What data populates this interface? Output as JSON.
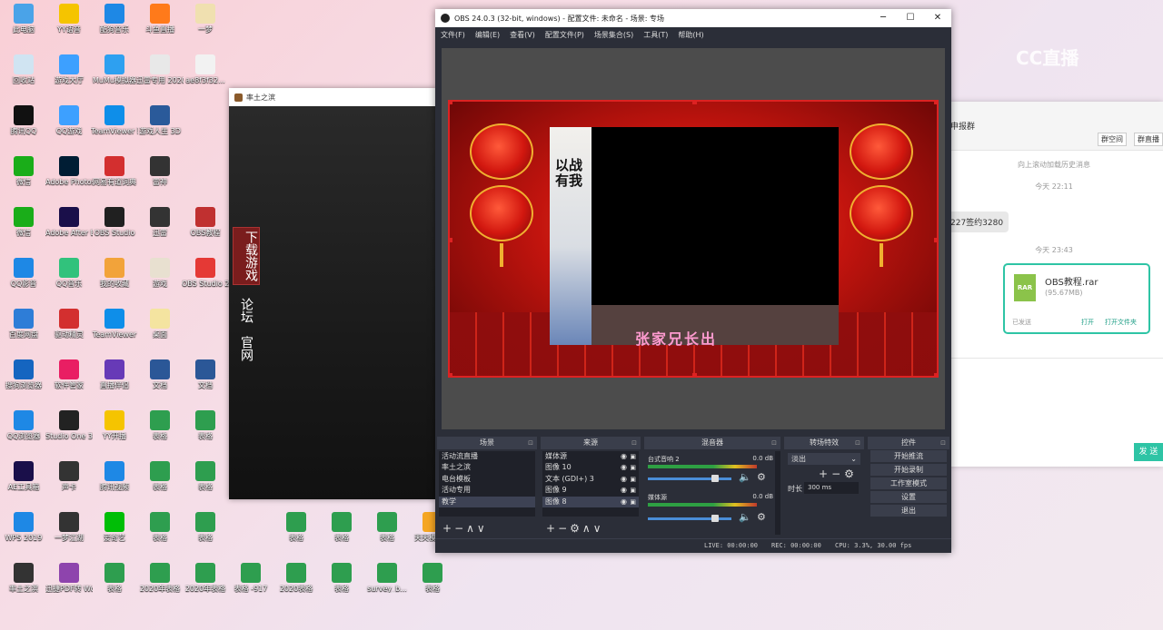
{
  "desktop": {
    "icons": [
      {
        "label": "此电脑",
        "icon": "computer-icon",
        "color": "#4aa3e8"
      },
      {
        "label": "YY语音",
        "icon": "yy-icon",
        "color": "#f5c400"
      },
      {
        "label": "酷狗音乐",
        "icon": "kugou-icon",
        "color": "#1e88e5"
      },
      {
        "label": "斗鱼直播",
        "icon": "douyu-icon",
        "color": "#ff7a1a"
      },
      {
        "label": "一梦",
        "icon": "app-icon",
        "color": "#f0e0b0"
      },
      {
        "label": "回收站",
        "icon": "recycle-bin-icon",
        "color": "#d0e4f2"
      },
      {
        "label": "游戏大厅",
        "icon": "game-hall-icon",
        "color": "#3da0ff"
      },
      {
        "label": "MuMu模拟器",
        "icon": "mumu-icon",
        "color": "#2ea0f0"
      },
      {
        "label": "迅雷专用 2020020...",
        "icon": "file-icon",
        "color": "#e8e8e8"
      },
      {
        "label": "ae8f3f32...",
        "icon": "file-icon",
        "color": "#f2f2f2"
      },
      {
        "label": "腾讯QQ",
        "icon": "qq-icon",
        "color": "#111111"
      },
      {
        "label": "QQ游戏",
        "icon": "qq-game-icon",
        "color": "#3da0ff"
      },
      {
        "label": "TeamViewer 取消(打开)",
        "icon": "teamviewer-icon",
        "color": "#0e8ee9"
      },
      {
        "label": "游戏人生 3D",
        "icon": "game-icon",
        "color": "#2a5a9a"
      },
      {
        "label": "微信",
        "icon": "wechat-icon",
        "color": "#1aad19"
      },
      {
        "label": "Adobe Photosh...",
        "icon": "photoshop-icon",
        "color": "#001d34"
      },
      {
        "label": "网易有道词典",
        "icon": "youdao-icon",
        "color": "#d32f2f"
      },
      {
        "label": "雷神",
        "icon": "device-icon",
        "color": "#333333"
      },
      {
        "label": "微信",
        "icon": "wechat-icon",
        "color": "#1aad19"
      },
      {
        "label": "Adobe After Effects 2019",
        "icon": "after-effects-icon",
        "color": "#1a0f4a"
      },
      {
        "label": "OBS Studio",
        "icon": "obs-icon",
        "color": "#202020"
      },
      {
        "label": "迅雷",
        "icon": "device-icon",
        "color": "#333333"
      },
      {
        "label": "OBS教程",
        "icon": "archive-icon",
        "color": "#c03030"
      },
      {
        "label": "QQ影音",
        "icon": "qq-player-icon",
        "color": "#1e88e5"
      },
      {
        "label": "QQ音乐",
        "icon": "qq-music-icon",
        "color": "#31c27c"
      },
      {
        "label": "我的收藏",
        "icon": "folder-icon",
        "color": "#f2a33a"
      },
      {
        "label": "游戏",
        "icon": "folder-icon",
        "color": "#e8e0d0"
      },
      {
        "label": "OBS Studio 21.1 GC下...",
        "icon": "pdf-icon",
        "color": "#e53935"
      },
      {
        "label": "百度网盘",
        "icon": "baidu-netdisk-icon",
        "color": "#2e7dd7"
      },
      {
        "label": "驱动精灵",
        "icon": "driver-icon",
        "color": "#d32f2f"
      },
      {
        "label": "TeamViewer",
        "icon": "teamviewer-icon",
        "color": "#0e8ee9"
      },
      {
        "label": "桌面",
        "icon": "folder-icon",
        "color": "#f4e4a0"
      },
      {
        "label": "搜狗浏览器",
        "icon": "sogou-icon",
        "color": "#1565c0"
      },
      {
        "label": "软件管家",
        "icon": "software-icon",
        "color": "#e91e63"
      },
      {
        "label": "直播伴侣",
        "icon": "live-icon",
        "color": "#673ab7"
      },
      {
        "label": "文档",
        "icon": "word-icon",
        "color": "#2b5797"
      },
      {
        "label": "文档",
        "icon": "word-icon",
        "color": "#2b5797"
      },
      {
        "label": "QQ浏览器",
        "icon": "qq-browser-icon",
        "color": "#1e88e5"
      },
      {
        "label": "Studio One 3",
        "icon": "studio-one-icon",
        "color": "#222222"
      },
      {
        "label": "YY开播",
        "icon": "yy-live-icon",
        "color": "#f5c400"
      },
      {
        "label": "表格",
        "icon": "excel-icon",
        "color": "#2e9e4f"
      },
      {
        "label": "表格",
        "icon": "excel-icon",
        "color": "#2e9e4f"
      },
      {
        "label": "AE工具箱",
        "icon": "ae-tool-icon",
        "color": "#1a0f4a"
      },
      {
        "label": "声卡",
        "icon": "app-icon",
        "color": "#333333"
      },
      {
        "label": "腾讯视频",
        "icon": "tencent-video-icon",
        "color": "#1e88e5"
      },
      {
        "label": "表格",
        "icon": "excel-icon",
        "color": "#2e9e4f"
      },
      {
        "label": "表格",
        "icon": "excel-icon",
        "color": "#2e9e4f"
      },
      {
        "label": "WPS 2019",
        "icon": "wps-icon",
        "color": "#1e88e5"
      },
      {
        "label": "一梦江湖",
        "icon": "game-icon",
        "color": "#333333"
      },
      {
        "label": "爱奇艺",
        "icon": "iqiyi-icon",
        "color": "#00be06"
      },
      {
        "label": "表格",
        "icon": "excel-icon",
        "color": "#2e9e4f"
      },
      {
        "label": "表格",
        "icon": "excel-icon",
        "color": "#2e9e4f"
      },
      {
        "label": "表格",
        "icon": "excel-icon",
        "color": "#2e9e4f"
      },
      {
        "label": "表格",
        "icon": "excel-icon",
        "color": "#2e9e4f"
      },
      {
        "label": "表格",
        "icon": "excel-icon",
        "color": "#2e9e4f"
      },
      {
        "label": "天天模拟器",
        "icon": "emulator-icon",
        "color": "#f5a623"
      },
      {
        "label": "率土之滨",
        "icon": "game-icon",
        "color": "#333333"
      },
      {
        "label": "迅捷PDF转 Word",
        "icon": "pdf-word-icon",
        "color": "#8e44ad"
      },
      {
        "label": "表格",
        "icon": "excel-icon",
        "color": "#2e9e4f"
      },
      {
        "label": "2020年表格",
        "icon": "excel-icon",
        "color": "#2e9e4f"
      },
      {
        "label": "2020年表格",
        "icon": "excel-icon",
        "color": "#2e9e4f"
      },
      {
        "label": "表格 -917",
        "icon": "excel-icon",
        "color": "#2e9e4f"
      },
      {
        "label": "2020表格",
        "icon": "excel-icon",
        "color": "#2e9e4f"
      },
      {
        "label": "表格",
        "icon": "excel-icon",
        "color": "#2e9e4f"
      },
      {
        "label": "survey_b...",
        "icon": "excel-icon",
        "color": "#2e9e4f"
      },
      {
        "label": "表格",
        "icon": "excel-icon",
        "color": "#2e9e4f"
      }
    ]
  },
  "launcher": {
    "title": "率土之滨",
    "download": "下载游戏",
    "forum": "论坛",
    "site": "官网"
  },
  "chat": {
    "title": "申报群",
    "btn1": "群空间",
    "btn2": "群直播",
    "history": "向上滚动加载历史消息",
    "time1": "今天 22:11",
    "message": "227签约3280",
    "time2": "今天 23:43",
    "file_name": "OBS教程.rar",
    "file_size": "(95.67MB)",
    "file_type": "RAR",
    "sent": "已发送",
    "open": "打开",
    "open_folder": "打开文件夹",
    "send": "发 送",
    "watermark": "CC直播"
  },
  "obs": {
    "title": "OBS 24.0.3 (32-bit, windows) - 配置文件: 未命名 - 场景: 专场",
    "menu": [
      "文件(F)",
      "编辑(E)",
      "查看(V)",
      "配置文件(P)",
      "场景集合(S)",
      "工具(T)",
      "帮助(H)"
    ],
    "preview": {
      "poster_text": "以战有我",
      "banner_text": "张家兄长出"
    },
    "scenes": {
      "header": "场景",
      "items": [
        "活动流直播",
        "率土之滨",
        "电台模板",
        "活动专用",
        "教学"
      ],
      "selected": 4
    },
    "sources": {
      "header": "来源",
      "items": [
        "媒体源",
        "图像 10",
        "文本 (GDI+) 3",
        "图像 9",
        "图像 8"
      ],
      "selected": 4
    },
    "mixer": {
      "header": "混音器",
      "channels": [
        {
          "name": "台式音响 2",
          "db": "0.0 dB",
          "volume": 0.8
        },
        {
          "name": "媒体源",
          "db": "0.0 dB",
          "volume": 0.8
        }
      ]
    },
    "transitions": {
      "header": "转场特效",
      "type": "淡出",
      "duration_label": "时长",
      "duration": "300 ms"
    },
    "controls": {
      "header": "控件",
      "buttons": [
        "开始推流",
        "开始录制",
        "工作室模式",
        "设置",
        "退出"
      ]
    },
    "status": {
      "live": "LIVE: 00:00:00",
      "rec": "REC: 00:00:00",
      "cpu": "CPU: 3.3%, 30.00 fps"
    }
  }
}
